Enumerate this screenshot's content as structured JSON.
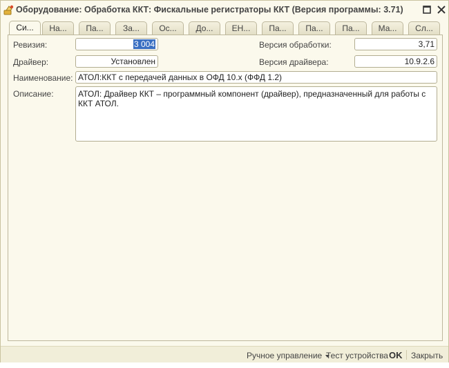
{
  "window": {
    "title": "Оборудование: Обработка ККТ: Фискальные регистраторы ККТ (Версия программы: 3.71)"
  },
  "tabs": [
    {
      "label": "Си..."
    },
    {
      "label": "На..."
    },
    {
      "label": "Па..."
    },
    {
      "label": "За..."
    },
    {
      "label": "Ос..."
    },
    {
      "label": "До..."
    },
    {
      "label": "ЕН..."
    },
    {
      "label": "Па..."
    },
    {
      "label": "Па..."
    },
    {
      "label": "Па..."
    },
    {
      "label": "Ма..."
    },
    {
      "label": "Сл..."
    }
  ],
  "form": {
    "revision_label": "Ревизия:",
    "revision_value": "3 004",
    "processing_version_label": "Версия обработки:",
    "processing_version_value": "3,71",
    "driver_label": "Драйвер:",
    "driver_value": "Установлен",
    "driver_version_label": "Версия драйвера:",
    "driver_version_value": "10.9.2.6",
    "name_label": "Наименование:",
    "name_value": "АТОЛ:ККТ с передачей данных в ОФД 10.х (ФФД 1.2)",
    "description_label": "Описание:",
    "description_value": "АТОЛ: Драйвер ККТ – программный компонент (драйвер), предназначенный для работы с ККТ АТОЛ."
  },
  "bottom_bar": {
    "manual_control": "Ручное управление",
    "device_test": "Тест устройства",
    "ok": "OK",
    "close": "Закрыть"
  },
  "icons": {
    "title_icon": "equipment-icon",
    "maximize": "maximize-icon",
    "close": "close-icon",
    "dropdown": "chevron-down-icon"
  },
  "colors": {
    "window_bg": "#fbf9ec",
    "selection": "#3a6fc2"
  }
}
